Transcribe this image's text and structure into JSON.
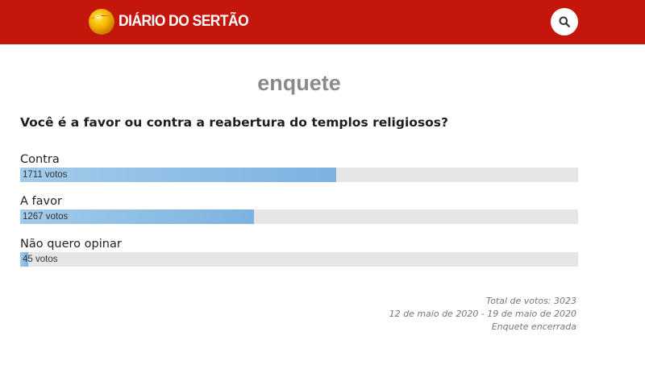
{
  "header": {
    "site_name": "DIÁRIO DO SERTÃO",
    "logo_icon": "sun-logo-icon",
    "search_icon": "search-icon",
    "brand_color": "#c4160b"
  },
  "page": {
    "title": "enquete"
  },
  "poll": {
    "question": "Você é a favor ou contra a reabertura do templos religiosos?",
    "options": [
      {
        "label": "Contra",
        "votes": 1711,
        "votes_text": "1711 votos"
      },
      {
        "label": "A favor",
        "votes": 1267,
        "votes_text": "1267 votos"
      },
      {
        "label": "Não quero opinar",
        "votes": 45,
        "votes_text": "45 votos"
      }
    ],
    "total_text": "Total de votos: 3023",
    "total_votes": 3023,
    "period_text": "12 de maio de 2020 - 19 de maio de 2020",
    "status_text": "Enquete encerrada",
    "bar_color": "#7cb2e0"
  }
}
